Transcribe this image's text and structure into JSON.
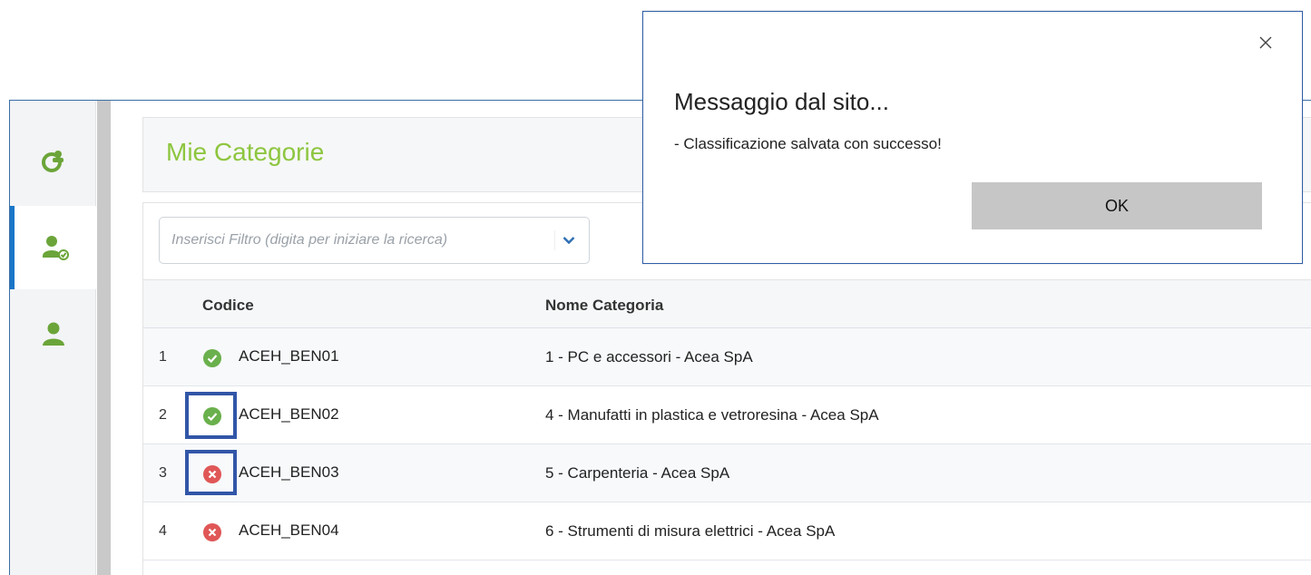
{
  "sidebar": {
    "items": [
      {
        "icon": "team-globe-icon"
      },
      {
        "icon": "user-check-icon",
        "active": true
      },
      {
        "icon": "user-icon"
      }
    ]
  },
  "page": {
    "title": "Mie Categorie"
  },
  "filter": {
    "placeholder": "Inserisci Filtro (digita per iniziare la ricerca)",
    "toggle_icon": "chevron-down-icon"
  },
  "table": {
    "columns": [
      "Codice",
      "Nome Categoria"
    ],
    "rows": [
      {
        "num": "1",
        "status": "ok",
        "code": "ACEH_BEN01",
        "name": "1 - PC e accessori - Acea SpA"
      },
      {
        "num": "2",
        "status": "ok",
        "code": "ACEH_BEN02",
        "name": "4 - Manufatti in plastica e vetroresina - Acea SpA"
      },
      {
        "num": "3",
        "status": "error",
        "code": "ACEH_BEN03",
        "name": "5 - Carpenteria - Acea SpA"
      },
      {
        "num": "4",
        "status": "error",
        "code": "ACEH_BEN04",
        "name": "6 - Strumenti di misura elettrici - Acea SpA"
      }
    ]
  },
  "dialog": {
    "title": "Messaggio dal sito...",
    "message": "- Classificazione salvata con successo!",
    "ok_label": "OK",
    "close_icon": "close-icon"
  },
  "colors": {
    "accent_green": "#8dc63f",
    "active_blue": "#1a76c8",
    "status_ok": "#6ab04c",
    "status_error": "#e05757",
    "highlight": "#3156a8"
  }
}
